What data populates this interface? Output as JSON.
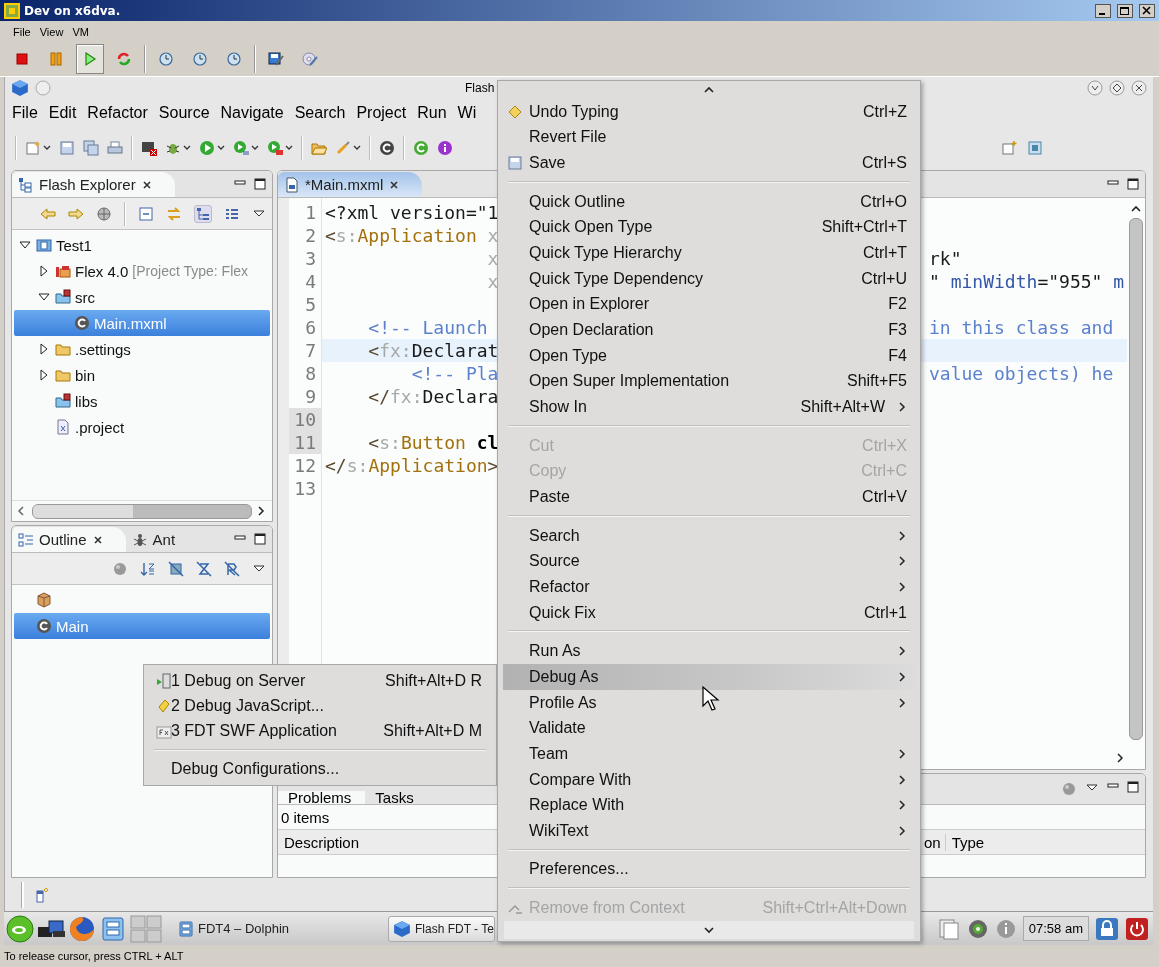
{
  "vm_window": {
    "title": "Dev on x6dva.",
    "menu": [
      "File",
      "View",
      "VM"
    ],
    "toolbar": [
      {
        "pressed": false
      },
      {
        "pressed": false
      },
      {
        "pressed": true
      },
      {
        "pressed": false
      },
      {
        "pressed": false
      },
      {
        "pressed": false
      },
      {
        "pressed": false
      },
      {
        "pressed": false
      },
      {
        "pressed": false
      }
    ],
    "status": "To release cursor, press CTRL + ALT"
  },
  "eclipse": {
    "title": "Flash",
    "menu": [
      "File",
      "Edit",
      "Refactor",
      "Source",
      "Navigate",
      "Search",
      "Project",
      "Run",
      "Wi"
    ],
    "explorer": {
      "tab": "Flash Explorer",
      "tree": [
        {
          "label": "Test1",
          "kind": "project",
          "expanded": true,
          "selected": false,
          "children": [
            {
              "label": "Flex 4.0",
              "detail": "[Project Type: Flex",
              "kind": "library",
              "expanded": false,
              "selected": false
            },
            {
              "label": "src",
              "kind": "source",
              "expanded": true,
              "selected": false,
              "children": [
                {
                  "label": "Main.mxml",
                  "kind": "class",
                  "selected": true
                }
              ]
            },
            {
              "label": ".settings",
              "kind": "folder",
              "expanded": false,
              "selected": false
            },
            {
              "label": "bin",
              "kind": "folder",
              "expanded": false,
              "selected": false
            },
            {
              "label": "libs",
              "kind": "source",
              "selected": false
            },
            {
              "label": ".project",
              "kind": "file",
              "selected": false
            }
          ]
        }
      ]
    },
    "outline": {
      "tabs": [
        {
          "label": "Outline",
          "selected": true
        },
        {
          "label": "Ant",
          "selected": false
        }
      ],
      "items": [
        {
          "kind": "package",
          "selected": false
        },
        {
          "kind": "class",
          "label": "Main",
          "selected": true
        }
      ]
    },
    "editor": {
      "tab": {
        "label": "*Main.mxml",
        "selected": true
      },
      "lines": [
        {
          "number": "1",
          "current": false,
          "marked": false,
          "left": [
            {
              "text": "<?xml version=\"1",
              "kind": "plain"
            }
          ]
        },
        {
          "number": "2",
          "current": false,
          "marked": false,
          "left": [
            {
              "text": "<",
              "kind": "punct"
            },
            {
              "text": "s:",
              "kind": "ns"
            },
            {
              "text": "Application",
              "kind": "tag"
            },
            {
              "text": " x",
              "kind": "faint"
            }
          ]
        },
        {
          "number": "3",
          "current": false,
          "marked": false,
          "left": [
            {
              "text": "               x",
              "kind": "faint"
            }
          ],
          "right": [
            {
              "text": "rk\"",
              "kind": "plain"
            }
          ]
        },
        {
          "number": "4",
          "current": false,
          "marked": false,
          "left": [
            {
              "text": "               x",
              "kind": "faint"
            }
          ],
          "right": [
            {
              "text": "\" ",
              "kind": "plain"
            },
            {
              "text": "minWidth",
              "kind": "attr"
            },
            {
              "text": "=\"955\" ",
              "kind": "plain"
            },
            {
              "text": "m",
              "kind": "attr"
            }
          ]
        },
        {
          "number": "5",
          "current": false,
          "marked": false
        },
        {
          "number": "6",
          "current": false,
          "marked": false,
          "left": [
            {
              "text": "    <!-- Launch",
              "kind": "comment"
            }
          ],
          "right": [
            {
              "text": "in this class and",
              "kind": "comment"
            }
          ]
        },
        {
          "number": "7",
          "current": true,
          "marked": false,
          "left": [
            {
              "text": "    <",
              "kind": "punct"
            },
            {
              "text": "fx:",
              "kind": "ns"
            },
            {
              "text": "Declarat",
              "kind": "plain"
            }
          ]
        },
        {
          "number": "8",
          "current": false,
          "marked": false,
          "left": [
            {
              "text": "        <!-- Pla",
              "kind": "comment"
            }
          ],
          "right": [
            {
              "text": "value objects) he",
              "kind": "comment"
            }
          ]
        },
        {
          "number": "9",
          "current": false,
          "marked": false,
          "left": [
            {
              "text": "    </",
              "kind": "punct"
            },
            {
              "text": "fx:",
              "kind": "ns"
            },
            {
              "text": "Declara",
              "kind": "plain"
            }
          ]
        },
        {
          "number": "10",
          "current": false,
          "marked": true
        },
        {
          "number": "11",
          "current": false,
          "marked": true,
          "left": [
            {
              "text": "    <",
              "kind": "punct"
            },
            {
              "text": "s:",
              "kind": "ns"
            },
            {
              "text": "Button",
              "kind": "tag"
            },
            {
              "text": " cl",
              "kind": "bold"
            }
          ]
        },
        {
          "number": "12",
          "current": false,
          "marked": false,
          "left": [
            {
              "text": "</",
              "kind": "punct"
            },
            {
              "text": "s:",
              "kind": "ns"
            },
            {
              "text": "Application",
              "kind": "tag"
            },
            {
              "text": ">",
              "kind": "punct"
            }
          ]
        },
        {
          "number": "13",
          "current": false,
          "marked": false
        }
      ]
    },
    "problems": {
      "tabs": [
        {
          "label": "Problems",
          "selected": true
        },
        {
          "label": "Tasks",
          "selected": false
        }
      ],
      "summary": "0 items",
      "columns": [
        "Description",
        "on",
        "Type"
      ]
    }
  },
  "taskbar": {
    "tasks": [
      {
        "label": "FDT4 – Dolphin",
        "selected": false
      },
      {
        "label": "Flash FDT - Te",
        "selected": true
      }
    ],
    "clock": "07:58 am"
  },
  "context_menu": {
    "items": [
      {
        "kind": "item",
        "label": "Undo Typing",
        "shortcut": "Ctrl+Z",
        "disabled": false,
        "submenu": false,
        "selected": false
      },
      {
        "kind": "item",
        "label": "Revert File",
        "disabled": false,
        "submenu": false,
        "selected": false
      },
      {
        "kind": "item",
        "label": "Save",
        "shortcut": "Ctrl+S",
        "disabled": false,
        "submenu": false,
        "selected": false
      },
      {
        "kind": "separator"
      },
      {
        "kind": "item",
        "label": "Quick Outline",
        "shortcut": "Ctrl+O",
        "disabled": false,
        "submenu": false,
        "selected": false
      },
      {
        "kind": "item",
        "label": "Quick Open Type",
        "shortcut": "Shift+Ctrl+T",
        "disabled": false,
        "submenu": false,
        "selected": false
      },
      {
        "kind": "item",
        "label": "Quick Type Hierarchy",
        "shortcut": "Ctrl+T",
        "disabled": false,
        "submenu": false,
        "selected": false
      },
      {
        "kind": "item",
        "label": "Quick Type Dependency",
        "shortcut": "Ctrl+U",
        "disabled": false,
        "submenu": false,
        "selected": false
      },
      {
        "kind": "item",
        "label": "Open in Explorer",
        "shortcut": "F2",
        "disabled": false,
        "submenu": false,
        "selected": false
      },
      {
        "kind": "item",
        "label": "Open Declaration",
        "shortcut": "F3",
        "disabled": false,
        "submenu": false,
        "selected": false
      },
      {
        "kind": "item",
        "label": "Open Type",
        "shortcut": "F4",
        "disabled": false,
        "submenu": false,
        "selected": false
      },
      {
        "kind": "item",
        "label": "Open Super Implementation",
        "shortcut": "Shift+F5",
        "disabled": false,
        "submenu": false,
        "selected": false
      },
      {
        "kind": "item",
        "label": "Show In",
        "shortcut": "Shift+Alt+W",
        "disabled": false,
        "submenu": true,
        "selected": false
      },
      {
        "kind": "separator"
      },
      {
        "kind": "item",
        "label": "Cut",
        "shortcut": "Ctrl+X",
        "disabled": true,
        "submenu": false,
        "selected": false
      },
      {
        "kind": "item",
        "label": "Copy",
        "shortcut": "Ctrl+C",
        "disabled": true,
        "submenu": false,
        "selected": false
      },
      {
        "kind": "item",
        "label": "Paste",
        "shortcut": "Ctrl+V",
        "disabled": false,
        "submenu": false,
        "selected": false
      },
      {
        "kind": "separator"
      },
      {
        "kind": "item",
        "label": "Search",
        "disabled": false,
        "submenu": true,
        "selected": false
      },
      {
        "kind": "item",
        "label": "Source",
        "disabled": false,
        "submenu": true,
        "selected": false
      },
      {
        "kind": "item",
        "label": "Refactor",
        "disabled": false,
        "submenu": true,
        "selected": false
      },
      {
        "kind": "item",
        "label": "Quick Fix",
        "shortcut": "Ctrl+1",
        "disabled": false,
        "submenu": false,
        "selected": false
      },
      {
        "kind": "separator"
      },
      {
        "kind": "item",
        "label": "Run As",
        "disabled": false,
        "submenu": true,
        "selected": false
      },
      {
        "kind": "item",
        "label": "Debug As",
        "disabled": false,
        "submenu": true,
        "selected": true
      },
      {
        "kind": "item",
        "label": "Profile As",
        "disabled": false,
        "submenu": true,
        "selected": false
      },
      {
        "kind": "item",
        "label": "Validate",
        "disabled": false,
        "submenu": false,
        "selected": false
      },
      {
        "kind": "item",
        "label": "Team",
        "disabled": false,
        "submenu": true,
        "selected": false
      },
      {
        "kind": "item",
        "label": "Compare With",
        "disabled": false,
        "submenu": true,
        "selected": false
      },
      {
        "kind": "item",
        "label": "Replace With",
        "disabled": false,
        "submenu": true,
        "selected": false
      },
      {
        "kind": "item",
        "label": "WikiText",
        "disabled": false,
        "submenu": true,
        "selected": false
      },
      {
        "kind": "separator"
      },
      {
        "kind": "item",
        "label": "Preferences...",
        "disabled": false,
        "submenu": false,
        "selected": false
      },
      {
        "kind": "separator"
      },
      {
        "kind": "item",
        "label": "Remove from Context",
        "shortcut": "Shift+Ctrl+Alt+Down",
        "disabled": true,
        "submenu": false,
        "selected": false
      }
    ]
  },
  "submenu": {
    "items": [
      {
        "kind": "item",
        "label": "1 Debug on Server",
        "shortcut": "Shift+Alt+D R"
      },
      {
        "kind": "item",
        "label": "2 Debug JavaScript..."
      },
      {
        "kind": "item",
        "label": "3 FDT SWF Application",
        "shortcut": "Shift+Alt+D M"
      },
      {
        "kind": "separator"
      },
      {
        "kind": "item",
        "label": "Debug Configurations..."
      }
    ]
  }
}
